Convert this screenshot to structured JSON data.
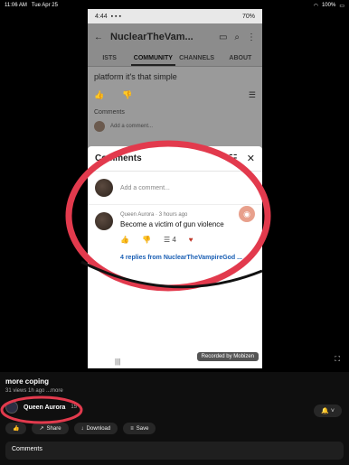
{
  "ipad_status": {
    "time": "11:06 AM",
    "date": "Tue Apr 25",
    "battery": "100%"
  },
  "phone": {
    "status": {
      "time": "4:44",
      "battery": "70%"
    },
    "header": {
      "title": "NuclearTheVam..."
    },
    "tabs": [
      "ISTS",
      "COMMUNITY",
      "CHANNELS",
      "ABOUT"
    ],
    "post": {
      "text": "platform it's that simple",
      "comments_label": "Comments",
      "add_comment": "Add a comment..."
    },
    "sheet": {
      "title": "Comments",
      "add_placeholder": "Add a comment...",
      "comment": {
        "author": "Queen Aurora",
        "time": "3 hours ago",
        "text": "Become a victim of gun violence",
        "replies_count": "4",
        "replies_link": "4 replies from NuclearTheVampireGod ..."
      }
    },
    "watermark": "Recorded by Mobizen"
  },
  "video_info": {
    "title": "more coping",
    "subtitle": "31 views  1h ago  ...more",
    "channel": {
      "name": "Queen Aurora",
      "subs": "15"
    },
    "actions": {
      "share": "Share",
      "download": "Download",
      "save": "Save"
    },
    "comments_label": "Comments"
  }
}
